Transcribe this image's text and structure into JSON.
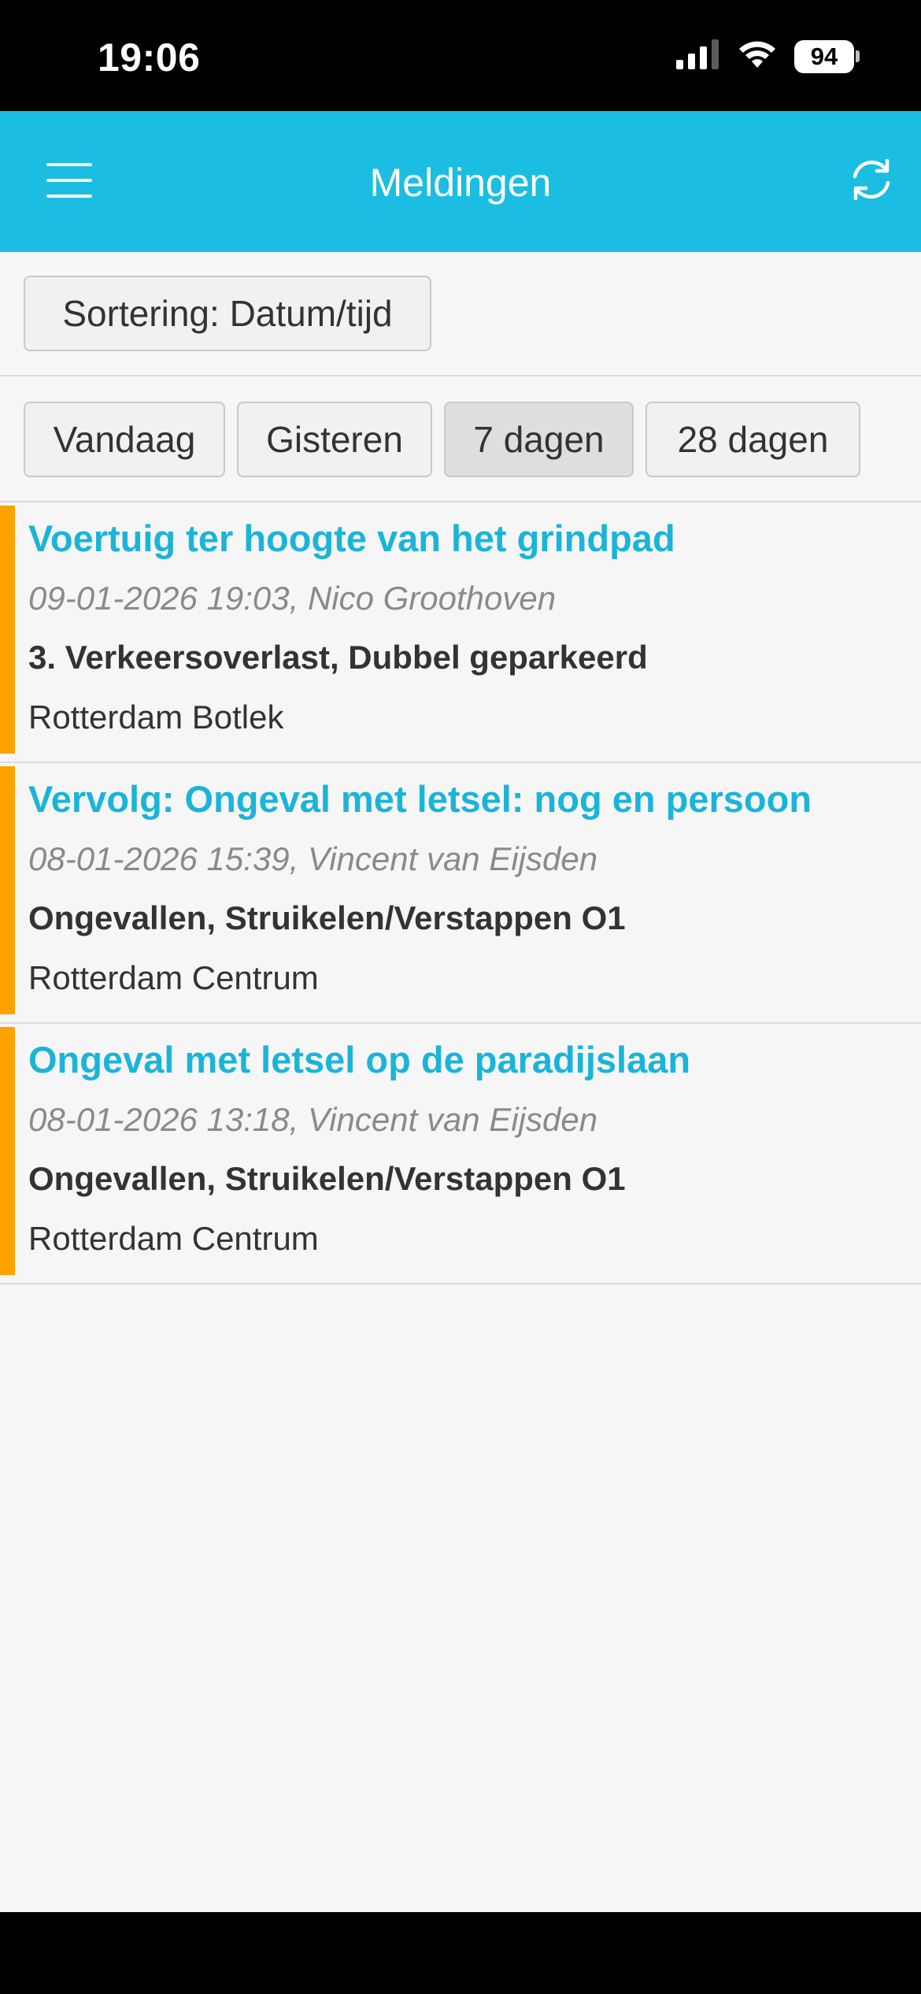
{
  "status_bar": {
    "time": "19:06",
    "battery": "94",
    "icons": [
      "signal-icon",
      "wifi-icon",
      "battery-icon"
    ]
  },
  "header": {
    "title": "Meldingen",
    "menu_icon": "hamburger-menu-icon",
    "refresh_icon": "refresh-icon",
    "color": "#1bbde2"
  },
  "sort": {
    "label": "Sortering: Datum/tijd"
  },
  "filters": {
    "items": [
      {
        "label": "Vandaag"
      },
      {
        "label": "Gisteren"
      },
      {
        "label": "7 dagen"
      },
      {
        "label": "28 dagen"
      }
    ],
    "selected": "7 dagen"
  },
  "notifications": [
    {
      "title": "Voertuig ter hoogte van het grindpad",
      "meta": "09-01-2026 19:03, Nico Groothoven",
      "category": "3. Verkeersoverlast, Dubbel geparkeerd",
      "location": "Rotterdam Botlek"
    },
    {
      "title": "Vervolg: Ongeval met letsel: nog en persoon",
      "meta": "08-01-2026 15:39, Vincent van Eijsden",
      "category": "Ongevallen, Struikelen/Verstappen O1",
      "location": "Rotterdam Centrum"
    },
    {
      "title": "Ongeval met letsel op de paradijslaan",
      "meta": "08-01-2026 13:18, Vincent van Eijsden",
      "category": "Ongevallen, Struikelen/Verstappen O1",
      "location": "Rotterdam Centrum"
    }
  ],
  "colors": {
    "accent": "#1bbde2",
    "title_text": "#1bb4d9",
    "priority_bar": "#fda300"
  }
}
